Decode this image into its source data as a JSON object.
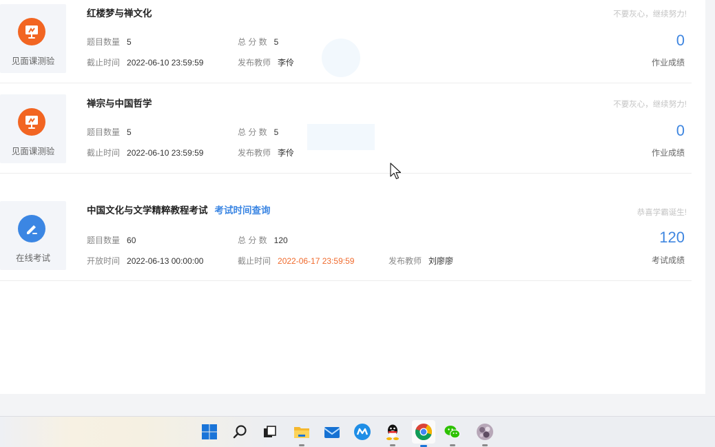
{
  "assignments": [
    {
      "badge_label": "见面课测验",
      "title": "红楼梦与禅文化",
      "fields": [
        {
          "label": "题目数量",
          "value": "5"
        },
        {
          "label": "总 分 数",
          "value": "5"
        },
        {
          "label": "截止时间",
          "value": "2022-06-10 23:59:59"
        },
        {
          "label": "发布教师",
          "value": "李伶"
        }
      ],
      "hint": "不要灰心，继续努力!",
      "score": "0",
      "score_label": "作业成绩",
      "badge_color": "#f26522"
    },
    {
      "badge_label": "见面课测验",
      "title": "禅宗与中国哲学",
      "fields": [
        {
          "label": "题目数量",
          "value": "5"
        },
        {
          "label": "总 分 数",
          "value": "5"
        },
        {
          "label": "截止时间",
          "value": "2022-06-10 23:59:59"
        },
        {
          "label": "发布教师",
          "value": "李伶"
        }
      ],
      "hint": "不要灰心，继续努力!",
      "score": "0",
      "score_label": "作业成绩",
      "badge_color": "#f26522"
    },
    {
      "badge_label": "在线考试",
      "title": "中国文化与文学精粹教程考试",
      "link": "考试时间查询",
      "fields": [
        {
          "label": "题目数量",
          "value": "60"
        },
        {
          "label": "总 分 数",
          "value": "120"
        },
        {
          "label": "开放时间",
          "value": "2022-06-13 00:00:00"
        },
        {
          "label": "截止时间",
          "value": "2022-06-17 23:59:59"
        },
        {
          "label": "发布教师",
          "value": "刘廖廖"
        }
      ],
      "hint": "恭喜学霸诞生!",
      "score": "120",
      "score_label": "考试成绩",
      "badge_color": "#3b86e3"
    }
  ],
  "taskbar": {
    "icons": [
      "windows-start-icon",
      "search-icon",
      "task-view-icon",
      "file-explorer-icon",
      "mail-icon",
      "app-icon",
      "qq-icon",
      "chrome-icon",
      "wechat-icon",
      "avatar-app-icon"
    ]
  }
}
